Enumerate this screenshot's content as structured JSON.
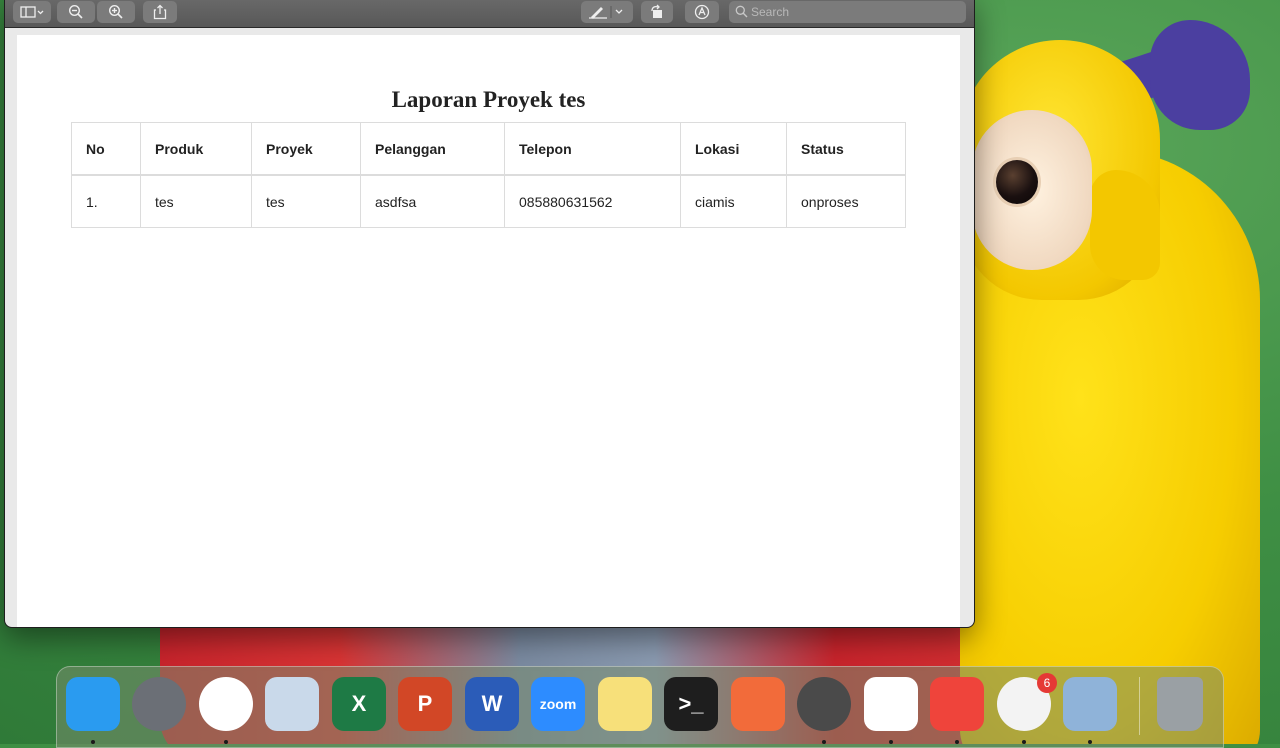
{
  "search": {
    "placeholder": "Search"
  },
  "report": {
    "title": "Laporan Proyek tes",
    "columns": [
      "No",
      "Produk",
      "Proyek",
      "Pelanggan",
      "Telepon",
      "Lokasi",
      "Status"
    ],
    "rows": [
      [
        "1.",
        "tes",
        "tes",
        "asdfsa",
        "085880631562",
        "ciamis",
        "onproses"
      ]
    ]
  },
  "dock": {
    "apps": [
      {
        "name": "finder-icon",
        "color": "#2a9bf0"
      },
      {
        "name": "launchpad-icon",
        "color": "#6b6f76"
      },
      {
        "name": "chrome-icon",
        "color": "#ffffff"
      },
      {
        "name": "mail-icon",
        "color": "#c9d9ea"
      },
      {
        "name": "excel-icon",
        "color": "#1e7a45",
        "glyph": "X"
      },
      {
        "name": "powerpoint-icon",
        "color": "#d24726",
        "glyph": "P"
      },
      {
        "name": "word-icon",
        "color": "#2b5cb8",
        "glyph": "W"
      },
      {
        "name": "zoom-icon",
        "color": "#2d8cff",
        "glyph": "zoom"
      },
      {
        "name": "notes-icon",
        "color": "#f7e07a"
      },
      {
        "name": "terminal-icon",
        "color": "#1e1e1e",
        "glyph": ">_"
      },
      {
        "name": "postman-icon",
        "color": "#f26b3a"
      },
      {
        "name": "sequel-ace-icon",
        "color": "#4a4a4a"
      },
      {
        "name": "vscode-icon",
        "color": "#ffffff"
      },
      {
        "name": "anydesk-icon",
        "color": "#ef443b"
      },
      {
        "name": "microsoft-store-icon",
        "color": "#f3f3f3",
        "badge": "6"
      },
      {
        "name": "preview-icon",
        "color": "#8fb3d9"
      }
    ],
    "trash": {
      "name": "trash-icon",
      "color": "#9aa0a4"
    }
  }
}
